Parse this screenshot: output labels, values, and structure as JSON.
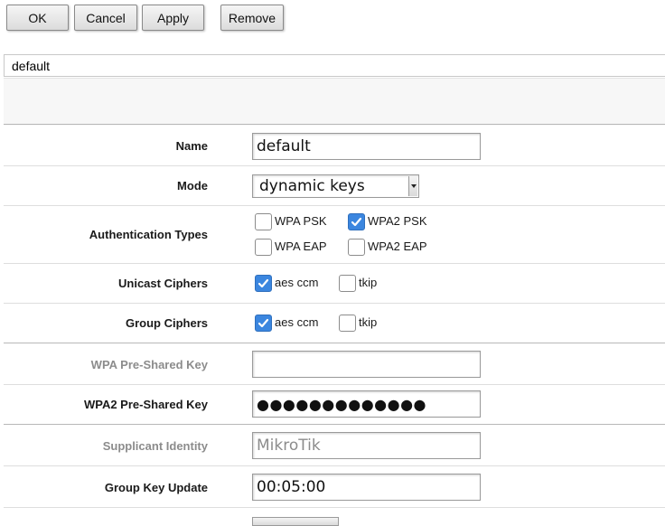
{
  "toolbar": {
    "ok_label": "OK",
    "cancel_label": "Cancel",
    "apply_label": "Apply",
    "remove_label": "Remove"
  },
  "profile_title": "default",
  "form": {
    "name": {
      "label": "Name",
      "value": "default"
    },
    "mode": {
      "label": "Mode",
      "value": "dynamic keys"
    },
    "authentication_types": {
      "label": "Authentication Types",
      "options": [
        {
          "label": "WPA PSK",
          "checked": false
        },
        {
          "label": "WPA2 PSK",
          "checked": true
        },
        {
          "label": "WPA EAP",
          "checked": false
        },
        {
          "label": "WPA2 EAP",
          "checked": false
        }
      ]
    },
    "unicast_ciphers": {
      "label": "Unicast Ciphers",
      "options": [
        {
          "label": "aes ccm",
          "checked": true
        },
        {
          "label": "tkip",
          "checked": false
        }
      ]
    },
    "group_ciphers": {
      "label": "Group Ciphers",
      "options": [
        {
          "label": "aes ccm",
          "checked": true
        },
        {
          "label": "tkip",
          "checked": false
        }
      ]
    },
    "wpa_psk": {
      "label": "WPA Pre-Shared Key",
      "value": ""
    },
    "wpa2_psk": {
      "label": "WPA2 Pre-Shared Key",
      "value": "●●●●●●●●●●●●●"
    },
    "supplicant_identity": {
      "label": "Supplicant Identity",
      "placeholder": "MikroTik"
    },
    "group_key_update": {
      "label": "Group Key Update",
      "value": "00:05:00"
    }
  },
  "colors": {
    "checkbox_checked": "#3b86df",
    "label_muted": "#8c8c8c"
  }
}
